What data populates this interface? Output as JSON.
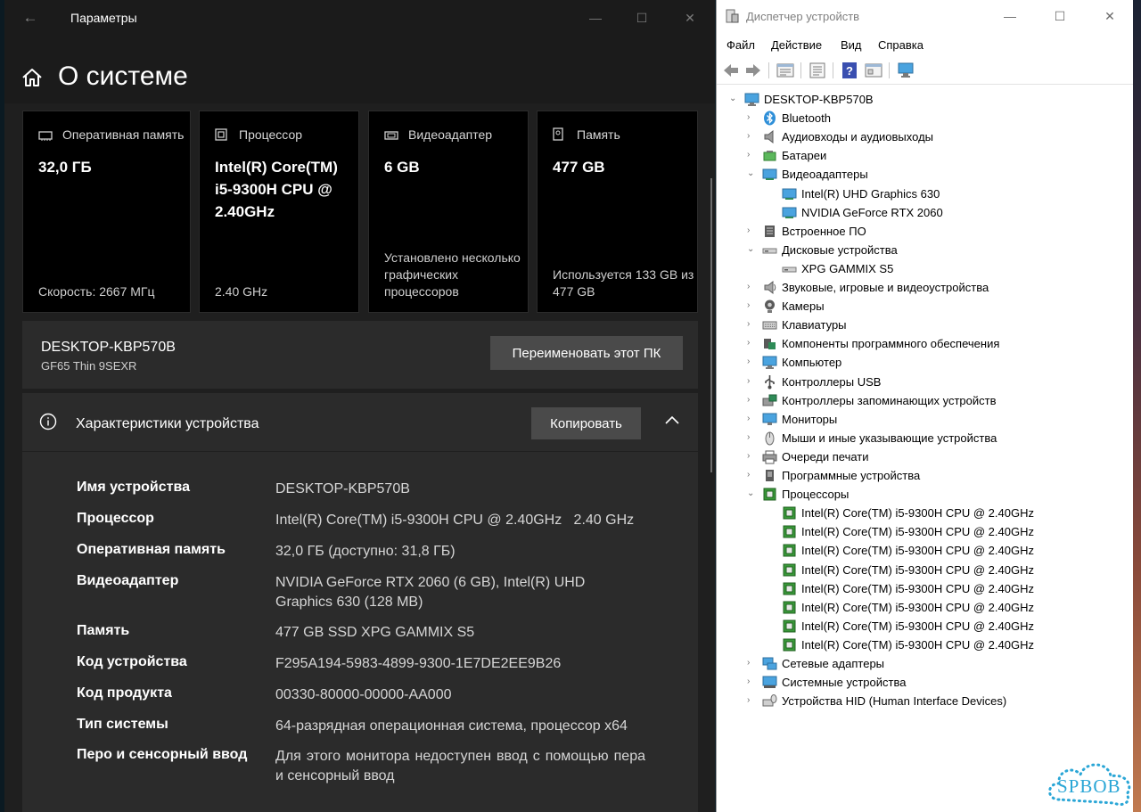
{
  "settings": {
    "window_title": "Параметры",
    "page_title": "О системе",
    "cards": [
      {
        "label": "Оперативная память",
        "value": "32,0 ГБ",
        "sub": "Скорость: 2667 МГц"
      },
      {
        "label": "Процессор",
        "value": "Intel(R) Core(TM) i5-9300H CPU @ 2.40GHz",
        "sub": "2.40 GHz"
      },
      {
        "label": "Видеоадаптер",
        "value": "6 GB",
        "sub": "Установлено несколько графических процессоров"
      },
      {
        "label": "Память",
        "value": "477 GB",
        "sub": "Используется 133 GB из 477 GB"
      }
    ],
    "pc": {
      "name": "DESKTOP-KBP570B",
      "model": "GF65 Thin 9SEXR",
      "rename_label": "Переименовать этот ПК"
    },
    "specs": {
      "title": "Характеристики устройства",
      "copy_label": "Копировать",
      "rows": [
        {
          "key": "Имя устройства",
          "value": "DESKTOP-KBP570B"
        },
        {
          "key": "Процессор",
          "value": "Intel(R) Core(TM) i5-9300H CPU @ 2.40GHz   2.40 GHz"
        },
        {
          "key": "Оперативная память",
          "value": "32,0 ГБ (доступно: 31,8 ГБ)"
        },
        {
          "key": "Видеоадаптер",
          "value": "NVIDIA GeForce RTX 2060 (6 GB), Intel(R) UHD Graphics 630 (128 MB)"
        },
        {
          "key": "Память",
          "value": "477 GB SSD XPG GAMMIX S5"
        },
        {
          "key": "Код устройства",
          "value": "F295A194-5983-4899-9300-1E7DE2EE9B26"
        },
        {
          "key": "Код продукта",
          "value": "00330-80000-00000-AA000"
        },
        {
          "key": "Тип системы",
          "value": "64-разрядная операционная система, процессор x64"
        },
        {
          "key": "Перо и сенсорный ввод",
          "value": "Для этого монитора недоступен ввод с помощью пера и сенсорный ввод"
        }
      ]
    }
  },
  "devmgr": {
    "window_title": "Диспетчер устройств",
    "menu": [
      "Файл",
      "Действие",
      "Вид",
      "Справка"
    ],
    "root": "DESKTOP-KBP570B",
    "categories": [
      {
        "label": "Bluetooth",
        "icon": "bluetooth-icon"
      },
      {
        "label": "Аудиовходы и аудиовыходы",
        "icon": "speaker-icon"
      },
      {
        "label": "Батареи",
        "icon": "battery-icon"
      },
      {
        "label": "Видеоадаптеры",
        "icon": "display-adapter-icon",
        "expanded": true,
        "children": [
          "Intel(R) UHD Graphics 630",
          "NVIDIA GeForce RTX 2060"
        ]
      },
      {
        "label": "Встроенное ПО",
        "icon": "firmware-icon"
      },
      {
        "label": "Дисковые устройства",
        "icon": "disk-drive-icon",
        "expanded": true,
        "children": [
          "XPG GAMMIX S5"
        ]
      },
      {
        "label": "Звуковые, игровые и видеоустройства",
        "icon": "sound-icon"
      },
      {
        "label": "Камеры",
        "icon": "camera-icon"
      },
      {
        "label": "Клавиатуры",
        "icon": "keyboard-icon"
      },
      {
        "label": "Компоненты программного обеспечения",
        "icon": "software-component-icon"
      },
      {
        "label": "Компьютер",
        "icon": "computer-icon"
      },
      {
        "label": "Контроллеры USB",
        "icon": "usb-icon"
      },
      {
        "label": "Контроллеры запоминающих устройств",
        "icon": "storage-controller-icon"
      },
      {
        "label": "Мониторы",
        "icon": "monitor-icon"
      },
      {
        "label": "Мыши и иные указывающие устройства",
        "icon": "mouse-icon"
      },
      {
        "label": "Очереди печати",
        "icon": "printer-icon"
      },
      {
        "label": "Программные устройства",
        "icon": "software-device-icon"
      },
      {
        "label": "Процессоры",
        "icon": "processor-icon",
        "expanded": true,
        "children": [
          "Intel(R) Core(TM) i5-9300H CPU @ 2.40GHz",
          "Intel(R) Core(TM) i5-9300H CPU @ 2.40GHz",
          "Intel(R) Core(TM) i5-9300H CPU @ 2.40GHz",
          "Intel(R) Core(TM) i5-9300H CPU @ 2.40GHz",
          "Intel(R) Core(TM) i5-9300H CPU @ 2.40GHz",
          "Intel(R) Core(TM) i5-9300H CPU @ 2.40GHz",
          "Intel(R) Core(TM) i5-9300H CPU @ 2.40GHz",
          "Intel(R) Core(TM) i5-9300H CPU @ 2.40GHz"
        ]
      },
      {
        "label": "Сетевые адаптеры",
        "icon": "network-icon"
      },
      {
        "label": "Системные устройства",
        "icon": "system-device-icon"
      },
      {
        "label": "Устройства HID (Human Interface Devices)",
        "icon": "hid-icon"
      }
    ]
  },
  "watermark": "SPBOB",
  "colors": {
    "settings_bg": "#1f1f1f",
    "card_bg": "#000000",
    "panel_bg": "#2b2b2b",
    "button_bg": "#4a4a4a",
    "accent_icon": "#2f8fd8",
    "processor_green": "#3a9a3a"
  }
}
